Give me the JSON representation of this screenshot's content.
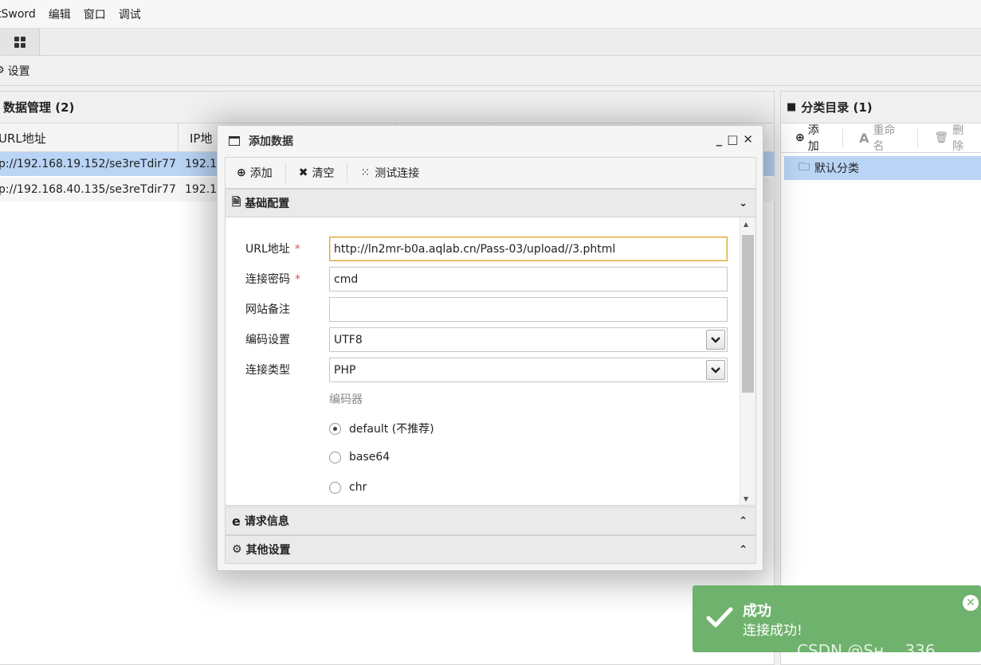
{
  "menubar": {
    "items": [
      "tSword",
      "编辑",
      "窗口",
      "调试"
    ]
  },
  "settings_tab": {
    "label": "设置"
  },
  "data_panel": {
    "title": "数据管理 (2)",
    "columns": [
      "URL地址",
      "IP地"
    ],
    "rows": [
      {
        "url": "p://192.168.19.152/se3reTdir77",
        "ip": "192.1"
      },
      {
        "url": "p://192.168.40.135/se3reTdir77",
        "ip": "192.1"
      }
    ]
  },
  "category_panel": {
    "title": "分类目录 (1)",
    "toolbar": {
      "add": "添加",
      "rename": "重命名",
      "delete": "删除"
    },
    "items": [
      "默认分类"
    ]
  },
  "dialog": {
    "title": "添加数据",
    "toolbar": {
      "add": "添加",
      "clear": "清空",
      "test": "测试连接"
    },
    "sections": {
      "basic": "基础配置",
      "request": "请求信息",
      "other": "其他设置"
    },
    "form": {
      "url_label": "URL地址",
      "url_value": "http://ln2mr-b0a.aqlab.cn/Pass-03/upload//3.phtml",
      "password_label": "连接密码",
      "password_value": "cmd",
      "note_label": "网站备注",
      "note_value": "",
      "encoding_label": "编码设置",
      "encoding_value": "UTF8",
      "type_label": "连接类型",
      "type_value": "PHP",
      "encoder_label": "编码器",
      "required_mark": "*",
      "encoders": [
        {
          "label": "default (不推荐)",
          "selected": true
        },
        {
          "label": "base64",
          "selected": false
        },
        {
          "label": "chr",
          "selected": false
        }
      ]
    }
  },
  "toast": {
    "title": "成功",
    "message": "连接成功!",
    "color": "#6fb26d"
  },
  "watermark": "CSDN @Sʜ      ，336"
}
